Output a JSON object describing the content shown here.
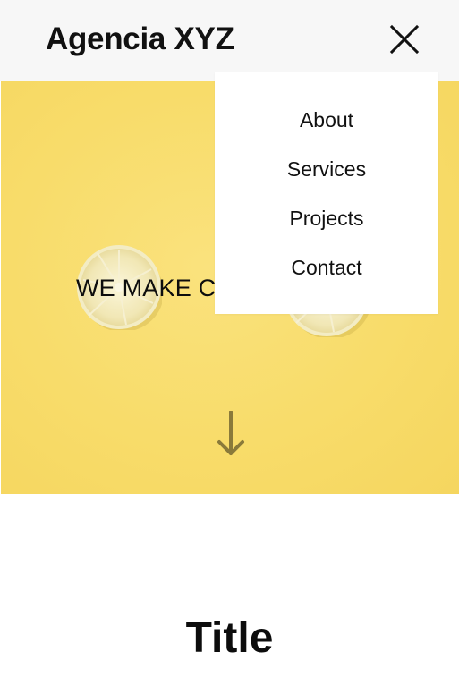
{
  "header": {
    "brand": "Agencia XYZ",
    "close_icon": "close-icon"
  },
  "menu": {
    "items": [
      {
        "label": "About"
      },
      {
        "label": "Services"
      },
      {
        "label": "Projects"
      },
      {
        "label": "Contact"
      }
    ]
  },
  "hero": {
    "headline": "WE MAKE C",
    "background_color": "#f9dd6c",
    "scroll_icon": "arrow-down-icon"
  },
  "section": {
    "title": "Title"
  }
}
